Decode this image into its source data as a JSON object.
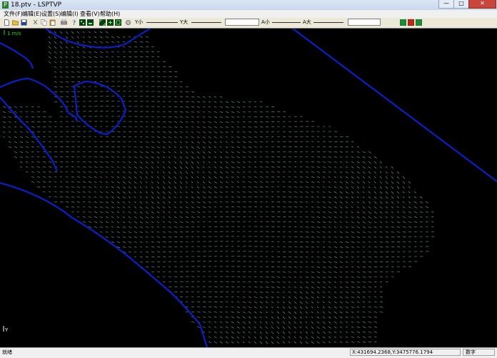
{
  "window": {
    "title": "18.ptv - LSPTVP",
    "app_icon": "P",
    "minimize_icon": "minimize-icon",
    "maximize_icon": "maximize-icon",
    "close_icon": "close-icon"
  },
  "menu": [
    "文件(F)",
    "编辑(E)",
    "设置(S)",
    "编辑(I)",
    "查看(V)",
    "帮助(H)"
  ],
  "toolbar": {
    "icons": [
      "new-file-icon",
      "open-folder-icon",
      "save-icon",
      "cut-icon",
      "copy-icon",
      "paste-icon",
      "print-icon",
      "help-icon",
      "grid-view-icon",
      "grid-view-2-icon",
      "zoom-fit-icon",
      "zoom-in-icon",
      "zoom-area-icon"
    ],
    "y_small": "Y小",
    "y_large": "Y大",
    "a_small": "A小",
    "a_large": "A大",
    "state_icons": [
      "green-square-icon",
      "red-square-icon",
      "green-square-2-icon"
    ],
    "colors": {
      "green": "#1f8a3a",
      "red": "#c0281c"
    }
  },
  "plot": {
    "scale_label": "1 m/s",
    "axis_label": "Y",
    "background": "#000000",
    "boundary_color": "#0a1fc8",
    "vector_color": "#7fe0d0",
    "scale_color": "#00e600"
  },
  "status": {
    "ready": "就绪",
    "coords": "X:431694.2368,Y:3475776.1794",
    "mode": "数字"
  }
}
